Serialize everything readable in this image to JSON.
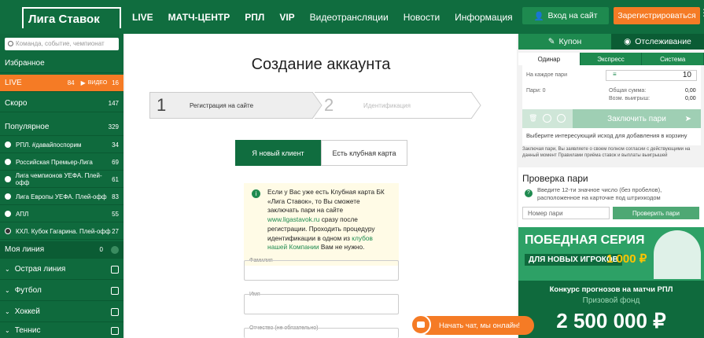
{
  "header": {
    "logo": "Лига Ставок",
    "nav": [
      "LIVE",
      "МАТЧ-ЦЕНТР",
      "РПЛ",
      "VIP",
      "Видеотрансляции",
      "Новости",
      "Информация"
    ],
    "login_label": "Вход на сайт",
    "register_label": "Зарегистрироваться"
  },
  "sidebar": {
    "search_placeholder": "Команда, событие, чемпионат",
    "favorites": "Избранное",
    "live": {
      "label": "LIVE",
      "count": "84",
      "video_label": "ВИДЕО",
      "video_count": "16"
    },
    "soon": {
      "label": "Скоро",
      "count": "147"
    },
    "popular": {
      "label": "Популярное",
      "count": "329"
    },
    "popular_items": [
      {
        "label": "РПЛ. #давайпоспорим",
        "count": "34"
      },
      {
        "label": "Российская Премьер-Лига",
        "count": "69"
      },
      {
        "label": "Лига чемпионов УЕФА. Плей-офф",
        "count": "61"
      },
      {
        "label": "Лига Европы УЕФА. Плей-офф",
        "count": "83"
      },
      {
        "label": "АПЛ",
        "count": "55"
      },
      {
        "label": "КХЛ. Кубок Гагарина. Плей-офф",
        "count": "27"
      }
    ],
    "my_line": {
      "label": "Моя линия",
      "count": "0"
    },
    "sports": [
      "Острая линия",
      "Футбол",
      "Хоккей",
      "Теннис"
    ]
  },
  "main": {
    "title": "Создание аккаунта",
    "step1_num": "1",
    "step1_label": "Регистрация на сайте",
    "step2_num": "2",
    "step2_label": "Идентификация",
    "tab_new": "Я новый клиент",
    "tab_card": "Есть клубная карта",
    "info_part1": "Если у Вас уже есть Клубная карта БК «Лига Ставок», то Вы сможете заключать пари на сайте ",
    "info_link1": "www.ligastavok.ru",
    "info_part2": " сразу после регистрации. Проходить процедуру идентификации в одном из ",
    "info_link2": "клубов нашей Компании",
    "info_part3": " Вам не нужно.",
    "fields": [
      "Фамилия",
      "Имя",
      "Отчество (не обязательно)"
    ]
  },
  "coupon": {
    "tab_coupon": "Купон",
    "tab_watch": "Отслеживание",
    "tabs": [
      "Одинар",
      "Экспресс",
      "Система"
    ],
    "stake_label": "На каждое пари",
    "stake_value": "10",
    "bets_label": "Пари: 0",
    "total_label": "Общая сумма:",
    "total_value": "0,00",
    "win_label": "Возм. выигрыш:",
    "win_value": "0,00",
    "place_label": "Заключить пари",
    "hint": "Выберите интересующий исход для добавления в корзину",
    "small_print": "Заключая пари, Вы заявляете о своем полном согласии с действующими на данный момент Правилами приёма ставок и выплаты выигрышей"
  },
  "check": {
    "title": "Проверка пари",
    "text": "Введите 12-ти значное число (без пробелов), расположенное на карточке под штрихкодом",
    "input_placeholder": "Номер пари",
    "button_label": "Проверить пари"
  },
  "promo": {
    "line1": "ПОБЕДНАЯ СЕРИЯ",
    "line2": "ДЛЯ НОВЫХ ИГРОКОВ",
    "amount": "1 000 ₽"
  },
  "contest": {
    "title": "Конкурс прогнозов на матчи РПЛ",
    "subtitle": "Призовой фонд",
    "amount": "2 500 000 ₽"
  },
  "chat": {
    "label": "Начать чат, мы онлайн!"
  }
}
